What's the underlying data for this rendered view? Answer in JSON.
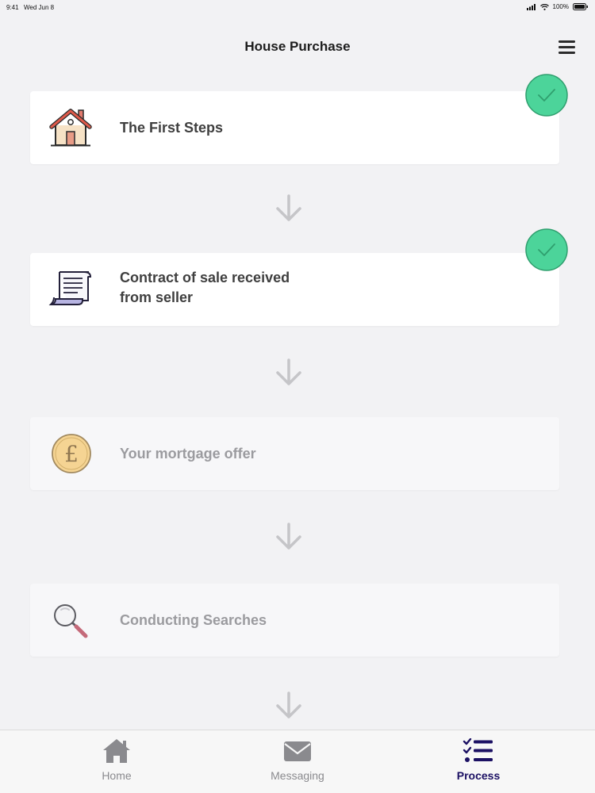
{
  "status_bar": {
    "time": "9:41",
    "date": "Wed Jun 8",
    "battery": "100%"
  },
  "header": {
    "title": "House Purchase",
    "menu_icon": "hamburger-menu-icon"
  },
  "steps": [
    {
      "title_line1": "The First Steps",
      "title_line2": "",
      "icon": "house-icon",
      "state": "complete"
    },
    {
      "title_line1": "Contract of sale received",
      "title_line2": "from seller",
      "icon": "contract-scroll-icon",
      "state": "complete"
    },
    {
      "title_line1": "Your mortgage offer",
      "title_line2": "",
      "icon": "pound-coin-icon",
      "state": "pending"
    },
    {
      "title_line1": "Conducting Searches",
      "title_line2": "",
      "icon": "magnifying-glass-icon",
      "state": "pending"
    }
  ],
  "tabs": [
    {
      "label": "Home",
      "icon": "home-icon",
      "active": false
    },
    {
      "label": "Messaging",
      "icon": "envelope-icon",
      "active": false
    },
    {
      "label": "Process",
      "icon": "checklist-icon",
      "active": true
    }
  ],
  "colors": {
    "check_green": "#4cd49a",
    "active_tab": "#1b1063",
    "inactive_tab": "#8a8a8e",
    "background": "#f2f2f4"
  }
}
